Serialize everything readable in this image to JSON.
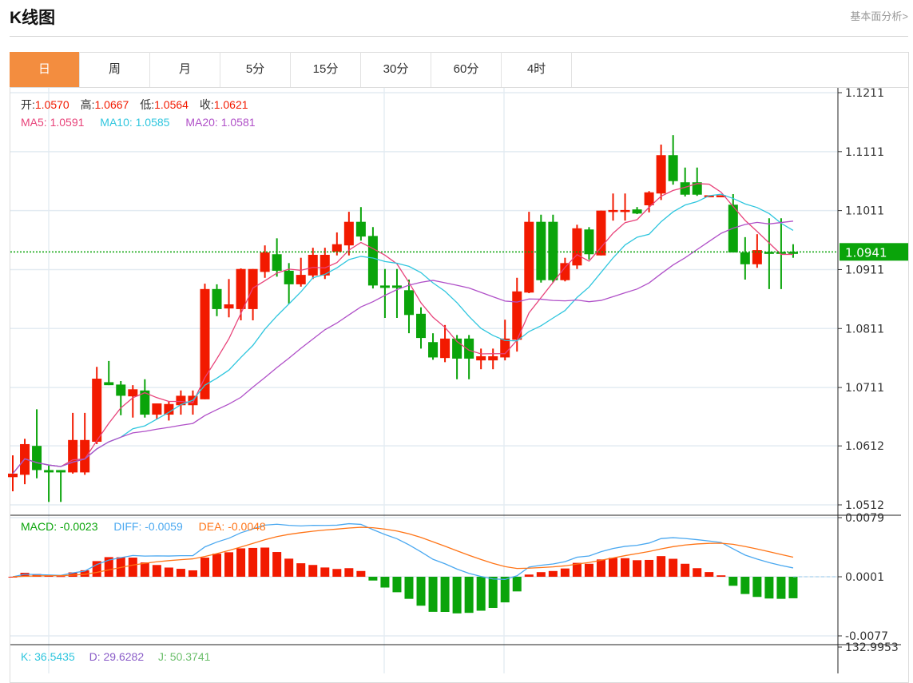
{
  "header": {
    "title": "K线图",
    "link": "基本面分析>"
  },
  "tabs": [
    {
      "label": "日",
      "active": true
    },
    {
      "label": "周"
    },
    {
      "label": "月"
    },
    {
      "label": "5分"
    },
    {
      "label": "15分"
    },
    {
      "label": "30分"
    },
    {
      "label": "60分"
    },
    {
      "label": "4时"
    }
  ],
  "ohlc": {
    "open_label": "开:",
    "open": "1.0570",
    "high_label": "高:",
    "high": "1.0667",
    "low_label": "低:",
    "low": "1.0564",
    "close_label": "收:",
    "close": "1.0621"
  },
  "ma": {
    "ma5": "MA5: 1.0591",
    "ma10": "MA10: 1.0585",
    "ma20": "MA20: 1.0581"
  },
  "macd_labels": {
    "macd": "MACD: -0.0023",
    "diff": "DIFF: -0.0059",
    "dea": "DEA: -0.0048"
  },
  "kdj_labels": {
    "k": "K: 36.5435",
    "d": "D: 29.6282",
    "j": "J: 50.3741"
  },
  "kdj_axis_top": "132.9953",
  "colors": {
    "up": "#f21a00",
    "down": "#0aa40a",
    "ma5": "#e8437a",
    "ma10": "#2fc6de",
    "ma20": "#b050c8",
    "diff": "#4aa8f0",
    "dea": "#ff7416",
    "accent": "#f38d3f"
  },
  "chart_data": {
    "type": "candlestick",
    "price_ticks": [
      "1.1211",
      "1.1111",
      "1.1011",
      "1.0911",
      "1.0811",
      "1.0711",
      "1.0612",
      "1.0512"
    ],
    "price_range": [
      1.0512,
      1.1211
    ],
    "last_price": "1.0941",
    "macd_ticks": [
      "0.0079",
      "0.0001",
      "-0.0077"
    ],
    "macd_range": [
      -0.0077,
      0.0079
    ],
    "candles": [
      [
        1.0559,
        1.0596,
        1.0535,
        1.0565
      ],
      [
        1.0563,
        1.0624,
        1.0547,
        1.0615
      ],
      [
        1.0612,
        1.0674,
        1.0557,
        1.0571
      ],
      [
        1.0571,
        1.058,
        1.0517,
        1.0567
      ],
      [
        1.0571,
        1.0571,
        1.0517,
        1.0567
      ],
      [
        1.0567,
        1.0668,
        1.0565,
        1.0622
      ],
      [
        1.0567,
        1.0668,
        1.0563,
        1.0622
      ],
      [
        1.0619,
        1.0746,
        1.0615,
        1.0726
      ],
      [
        1.072,
        1.0756,
        1.0715,
        1.0715
      ],
      [
        1.0716,
        1.0722,
        1.0664,
        1.0697
      ],
      [
        1.0696,
        1.0715,
        1.066,
        1.0708
      ],
      [
        1.0706,
        1.0725,
        1.066,
        1.0665
      ],
      [
        1.0665,
        1.0684,
        1.0657,
        1.0684
      ],
      [
        1.0665,
        1.0688,
        1.0655,
        1.0683
      ],
      [
        1.0681,
        1.0706,
        1.0665,
        1.0697
      ],
      [
        1.0681,
        1.0706,
        1.0665,
        1.0697
      ],
      [
        1.0691,
        1.0887,
        1.0691,
        1.0878
      ],
      [
        1.0878,
        1.0886,
        1.0832,
        1.0844
      ],
      [
        1.0845,
        1.0895,
        1.083,
        1.0852
      ],
      [
        1.0844,
        1.0913,
        1.0825,
        1.0912
      ],
      [
        1.0844,
        1.0912,
        1.0825,
        1.0912
      ],
      [
        1.0907,
        1.0952,
        1.0897,
        1.094
      ],
      [
        1.0937,
        1.0964,
        1.0899,
        1.0909
      ],
      [
        1.0909,
        1.0922,
        1.0853,
        1.0886
      ],
      [
        1.0886,
        1.0931,
        1.0882,
        1.0902
      ],
      [
        1.0901,
        1.0948,
        1.0895,
        1.0936
      ],
      [
        1.0901,
        1.0948,
        1.0895,
        1.0936
      ],
      [
        1.0941,
        1.0974,
        1.0935,
        1.0954
      ],
      [
        1.0952,
        1.1009,
        1.0935,
        1.0992
      ],
      [
        1.0992,
        1.1017,
        1.096,
        1.0967
      ],
      [
        1.0968,
        1.0983,
        1.0879,
        1.0884
      ],
      [
        1.0884,
        1.0912,
        1.0829,
        1.088
      ],
      [
        1.0884,
        1.0912,
        1.0829,
        1.088
      ],
      [
        1.0876,
        1.0894,
        1.0803,
        1.0834
      ],
      [
        1.0836,
        1.0847,
        1.0777,
        1.0795
      ],
      [
        1.0788,
        1.0803,
        1.0758,
        1.0762
      ],
      [
        1.0761,
        1.0817,
        1.0754,
        1.0794
      ],
      [
        1.0794,
        1.08,
        1.0725,
        1.076
      ],
      [
        1.0794,
        1.08,
        1.0725,
        1.076
      ],
      [
        1.0757,
        1.0777,
        1.0742,
        1.0764
      ],
      [
        1.0757,
        1.0777,
        1.0742,
        1.0764
      ],
      [
        1.0762,
        1.0826,
        1.0757,
        1.0794
      ],
      [
        1.0792,
        1.0897,
        1.0772,
        1.0874
      ],
      [
        1.0872,
        1.1009,
        1.0871,
        1.0992
      ],
      [
        1.0992,
        1.1004,
        1.0889,
        1.0893
      ],
      [
        1.0992,
        1.1004,
        1.0889,
        1.0893
      ],
      [
        1.0893,
        1.0931,
        1.0891,
        1.0922
      ],
      [
        1.0918,
        1.0987,
        1.0912,
        1.0981
      ],
      [
        1.0979,
        1.0983,
        1.0928,
        1.0937
      ],
      [
        1.0935,
        1.1011,
        1.0935,
        1.1011
      ],
      [
        1.1009,
        1.104,
        1.0994,
        1.1012
      ],
      [
        1.1009,
        1.104,
        1.0994,
        1.1012
      ],
      [
        1.1013,
        1.1017,
        1.1005,
        1.1006
      ],
      [
        1.102,
        1.1044,
        1.1008,
        1.1042
      ],
      [
        1.104,
        1.1123,
        1.1029,
        1.1105
      ],
      [
        1.1105,
        1.1139,
        1.1055,
        1.1061
      ],
      [
        1.1059,
        1.1084,
        1.1035,
        1.1038
      ],
      [
        1.1059,
        1.1084,
        1.1036,
        1.1038
      ],
      [
        1.1036,
        1.1037,
        1.1036,
        1.1037
      ],
      [
        1.1036,
        1.1037,
        1.1036,
        1.1037
      ],
      [
        1.1021,
        1.1039,
        1.094,
        1.094
      ],
      [
        1.094,
        1.0966,
        1.0894,
        1.092
      ],
      [
        1.092,
        1.0971,
        1.0914,
        1.0944
      ],
      [
        1.0941,
        1.0998,
        1.0878,
        1.094
      ],
      [
        1.0941,
        1.0998,
        1.0878,
        1.094
      ],
      [
        1.0941,
        1.0954,
        1.0931,
        1.094
      ]
    ]
  }
}
